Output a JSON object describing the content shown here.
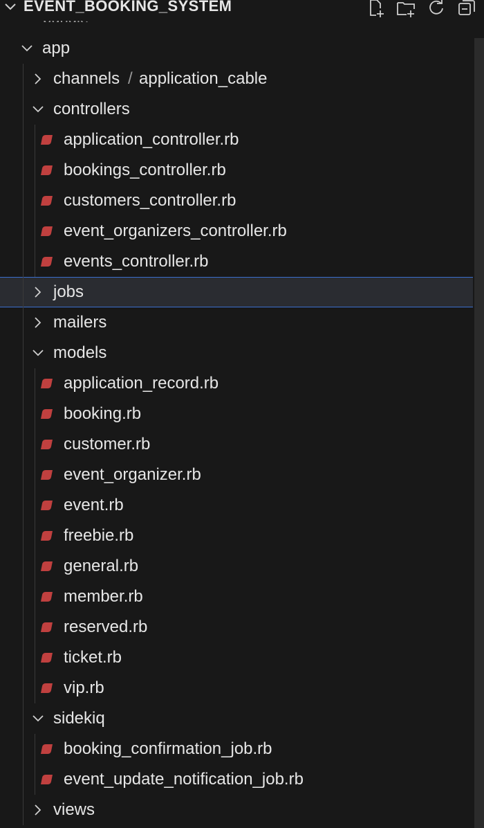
{
  "explorer": {
    "title": "EVENT_BOOKING_SYSTEM",
    "partial_item_label": "bundle",
    "actions": [
      {
        "name": "new-file-button",
        "icon": "new-file-icon"
      },
      {
        "name": "new-folder-button",
        "icon": "new-folder-icon"
      },
      {
        "name": "refresh-button",
        "icon": "refresh-icon"
      },
      {
        "name": "collapse-all-button",
        "icon": "collapse-all-icon"
      }
    ]
  },
  "tree": [
    {
      "label": "app",
      "type": "folder",
      "expanded": true,
      "depth": 0
    },
    {
      "label": "channels",
      "type": "folder",
      "expanded": false,
      "depth": 1,
      "compact_suffix": "application_cable"
    },
    {
      "label": "controllers",
      "type": "folder",
      "expanded": true,
      "depth": 1
    },
    {
      "label": "application_controller.rb",
      "type": "ruby",
      "depth": 2
    },
    {
      "label": "bookings_controller.rb",
      "type": "ruby",
      "depth": 2
    },
    {
      "label": "customers_controller.rb",
      "type": "ruby",
      "depth": 2
    },
    {
      "label": "event_organizers_controller.rb",
      "type": "ruby",
      "depth": 2
    },
    {
      "label": "events_controller.rb",
      "type": "ruby",
      "depth": 2
    },
    {
      "label": "jobs",
      "type": "folder",
      "expanded": false,
      "depth": 1,
      "selected": true
    },
    {
      "label": "mailers",
      "type": "folder",
      "expanded": false,
      "depth": 1
    },
    {
      "label": "models",
      "type": "folder",
      "expanded": true,
      "depth": 1
    },
    {
      "label": "application_record.rb",
      "type": "ruby",
      "depth": 2
    },
    {
      "label": "booking.rb",
      "type": "ruby",
      "depth": 2
    },
    {
      "label": "customer.rb",
      "type": "ruby",
      "depth": 2
    },
    {
      "label": "event_organizer.rb",
      "type": "ruby",
      "depth": 2
    },
    {
      "label": "event.rb",
      "type": "ruby",
      "depth": 2
    },
    {
      "label": "freebie.rb",
      "type": "ruby",
      "depth": 2
    },
    {
      "label": "general.rb",
      "type": "ruby",
      "depth": 2
    },
    {
      "label": "member.rb",
      "type": "ruby",
      "depth": 2
    },
    {
      "label": "reserved.rb",
      "type": "ruby",
      "depth": 2
    },
    {
      "label": "ticket.rb",
      "type": "ruby",
      "depth": 2
    },
    {
      "label": "vip.rb",
      "type": "ruby",
      "depth": 2
    },
    {
      "label": "sidekiq",
      "type": "folder",
      "expanded": true,
      "depth": 1
    },
    {
      "label": "booking_confirmation_job.rb",
      "type": "ruby",
      "depth": 2
    },
    {
      "label": "event_update_notification_job.rb",
      "type": "ruby",
      "depth": 2
    },
    {
      "label": "views",
      "type": "folder",
      "expanded": false,
      "depth": 1
    }
  ],
  "colors": {
    "background": "#181818",
    "text": "#e6e6e6",
    "ruby_icon": "#c0403f",
    "selection_border": "#3b6fcf",
    "selection_bg": "#2a2c31"
  }
}
